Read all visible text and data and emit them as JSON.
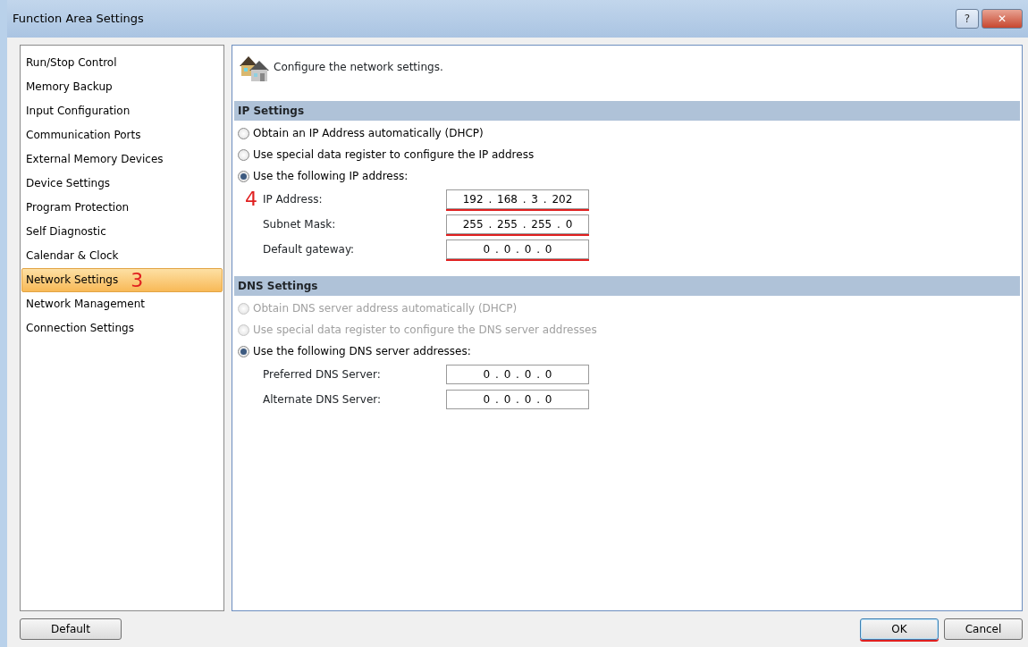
{
  "window": {
    "title": "Function Area Settings",
    "controls": [
      "?",
      "✕"
    ]
  },
  "sidebar": {
    "items": [
      {
        "label": "Run/Stop Control",
        "selected": false
      },
      {
        "label": "Memory Backup",
        "selected": false
      },
      {
        "label": "Input Configuration",
        "selected": false
      },
      {
        "label": "Communication Ports",
        "selected": false
      },
      {
        "label": "External Memory Devices",
        "selected": false
      },
      {
        "label": "Device Settings",
        "selected": false
      },
      {
        "label": "Program Protection",
        "selected": false
      },
      {
        "label": "Self Diagnostic",
        "selected": false
      },
      {
        "label": "Calendar & Clock",
        "selected": false
      },
      {
        "label": "Network Settings",
        "selected": true,
        "annotation": "3"
      },
      {
        "label": "Network Management",
        "selected": false
      },
      {
        "label": "Connection Settings",
        "selected": false
      }
    ]
  },
  "header": {
    "text": "Configure the network settings."
  },
  "sections": [
    {
      "title": "IP Settings",
      "options": [
        {
          "label": "Obtain an IP Address automatically (DHCP)",
          "selected": false,
          "disabled": false
        },
        {
          "label": "Use special data register to configure the IP address",
          "selected": false,
          "disabled": false
        },
        {
          "label": "Use the following IP address:",
          "selected": true,
          "disabled": false
        }
      ],
      "fields": [
        {
          "label": "IP Address:",
          "value": "192 . 168 . 3 . 202",
          "annotation": "4",
          "underlined": true
        },
        {
          "label": "Subnet Mask:",
          "value": "255 . 255 . 255 . 0",
          "underlined": true
        },
        {
          "label": "Default gateway:",
          "value": "0 . 0 . 0 . 0",
          "underlined": true
        }
      ]
    },
    {
      "title": "DNS Settings",
      "options": [
        {
          "label": "Obtain DNS server address automatically (DHCP)",
          "selected": false,
          "disabled": true
        },
        {
          "label": "Use special data register to configure the DNS server addresses",
          "selected": false,
          "disabled": true
        },
        {
          "label": "Use the following DNS server addresses:",
          "selected": true,
          "disabled": false
        }
      ],
      "fields": [
        {
          "label": "Preferred DNS Server:",
          "value": "0 . 0 . 0 . 0",
          "underlined": false
        },
        {
          "label": "Alternate DNS Server:",
          "value": "0 . 0 . 0 . 0",
          "underlined": false
        }
      ]
    }
  ],
  "buttons": {
    "left": [
      {
        "label": "Default",
        "focused": false
      }
    ],
    "right": [
      {
        "label": "OK",
        "focused": true
      },
      {
        "label": "Cancel",
        "focused": false
      }
    ]
  }
}
